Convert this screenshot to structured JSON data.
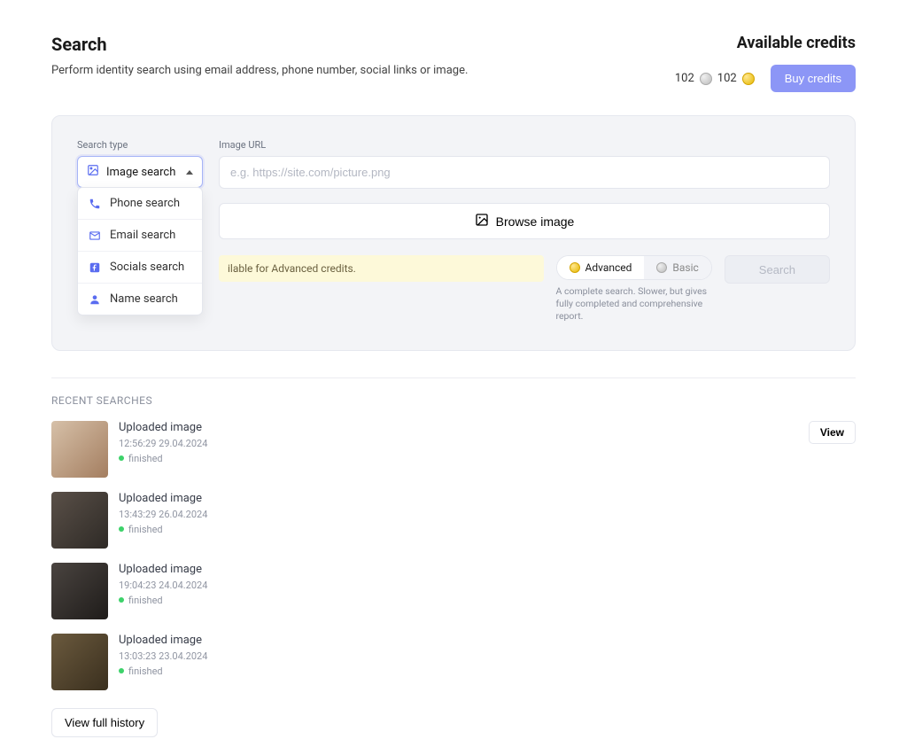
{
  "header": {
    "title": "Search",
    "subtitle": "Perform identity search using email address, phone number, social links or image."
  },
  "credits": {
    "title": "Available credits",
    "silver": "102",
    "gold": "102",
    "buy_label": "Buy credits"
  },
  "form": {
    "search_type_label": "Search type",
    "selected_type": "Image search",
    "image_url_label": "Image URL",
    "image_url_placeholder": "e.g. https://site.com/picture.png",
    "browse_label": "Browse image",
    "notice": "ilable for Advanced credits.",
    "mode_advanced": "Advanced",
    "mode_basic": "Basic",
    "mode_desc": "A complete search. Slower, but gives fully completed and comprehensive report.",
    "search_label": "Search",
    "dropdown": [
      {
        "label": "Phone search",
        "icon": "phone"
      },
      {
        "label": "Email search",
        "icon": "mail"
      },
      {
        "label": "Socials search",
        "icon": "social"
      },
      {
        "label": "Name search",
        "icon": "person"
      }
    ]
  },
  "recent": {
    "section_title": "Recent Searches",
    "view_label": "View",
    "full_history_label": "View full history",
    "items": [
      {
        "title": "Uploaded image",
        "time": "12:56:29 29.04.2024",
        "status": "finished"
      },
      {
        "title": "Uploaded image",
        "time": "13:43:29 26.04.2024",
        "status": "finished"
      },
      {
        "title": "Uploaded image",
        "time": "19:04:23 24.04.2024",
        "status": "finished"
      },
      {
        "title": "Uploaded image",
        "time": "13:03:23 23.04.2024",
        "status": "finished"
      }
    ]
  }
}
